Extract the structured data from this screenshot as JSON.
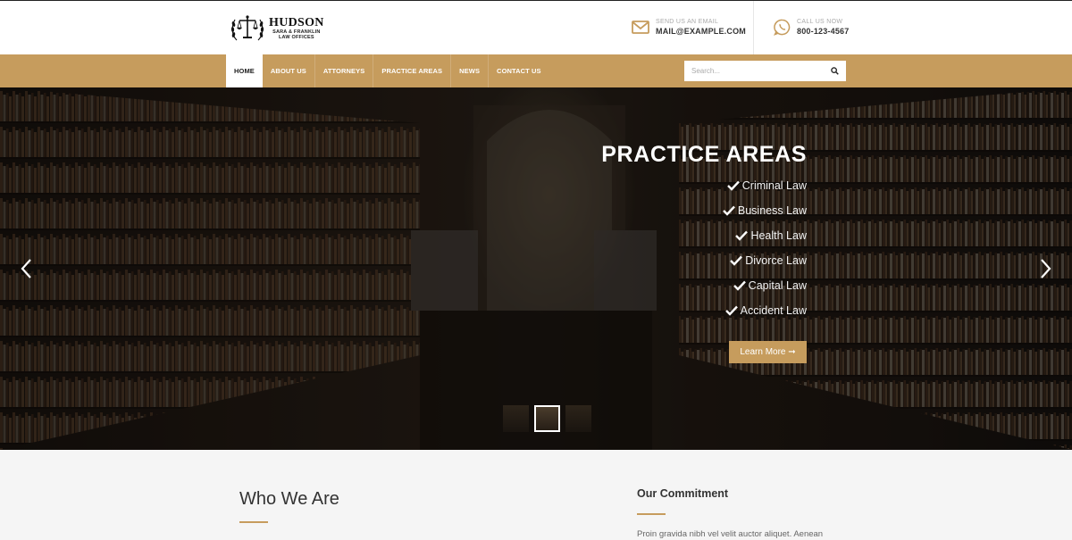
{
  "header": {
    "logo": {
      "title": "HUDSON",
      "line1": "SARA & FRANKLIN",
      "line2": "LAW OFFICES"
    },
    "email": {
      "label": "SEND US AN EMAIL",
      "value": "MAIL@EXAMPLE.COM",
      "icon": "envelope-icon"
    },
    "phone": {
      "label": "CALL US NOW",
      "value": "800-123-4567",
      "icon": "whatsapp-icon"
    }
  },
  "nav": {
    "items": [
      {
        "label": "HOME",
        "active": true
      },
      {
        "label": "ABOUT US"
      },
      {
        "label": "ATTORNEYS"
      },
      {
        "label": "PRACTICE AREAS"
      },
      {
        "label": "NEWS"
      },
      {
        "label": "CONTACT US"
      }
    ],
    "search": {
      "placeholder": "Search...",
      "icon": "search-icon"
    }
  },
  "hero": {
    "title": "PRACTICE AREAS",
    "items": [
      "Criminal Law",
      "Business Law",
      "Health Law",
      "Divorce Law",
      "Capital Law",
      "Accident Law"
    ],
    "button": "Learn More ➞",
    "slides_total": 3,
    "active_slide": 2
  },
  "about": {
    "left_title": "Who We Are",
    "right_title": "Our Commitment",
    "right_text": "Proin gravida nibh vel velit auctor aliquet. Aenean"
  },
  "colors": {
    "accent": "#c69c5d",
    "text_dark": "#333333",
    "header_bg": "#ffffff"
  }
}
